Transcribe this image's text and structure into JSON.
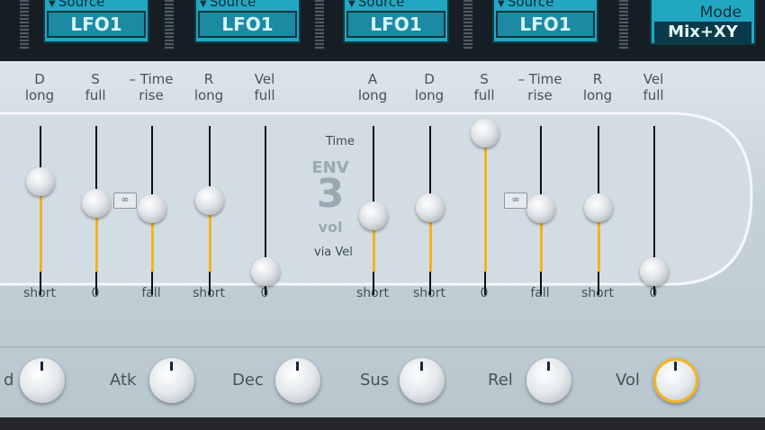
{
  "sources": [
    {
      "label": "Source",
      "value": "LFO1"
    },
    {
      "label": "Source",
      "value": "LFO1"
    },
    {
      "label": "Source",
      "value": "LFO1"
    },
    {
      "label": "Source",
      "value": "LFO1"
    }
  ],
  "mode": {
    "label": "Mode",
    "value": "Mix+XY"
  },
  "env_label": {
    "env": "ENV",
    "number": "3",
    "vol": "vol",
    "time": "Time",
    "via_vel": "via Vel"
  },
  "sliders": [
    {
      "id": "d-left",
      "top": "D",
      "top2": "long",
      "bottom": "short",
      "level": 0.62
    },
    {
      "id": "s-left",
      "top": "S",
      "top2": "full",
      "bottom": "0",
      "level": 0.47
    },
    {
      "id": "time-left",
      "top": "– Time",
      "top2": "rise",
      "bottom": "fall",
      "level": 0.43
    },
    {
      "id": "r-left",
      "top": "R",
      "top2": "long",
      "bottom": "short",
      "level": 0.49
    },
    {
      "id": "vel-left",
      "top": "Vel",
      "top2": "full",
      "bottom": "0",
      "level": 0.0
    },
    {
      "id": "a-right",
      "top": "A",
      "top2": "long",
      "bottom": "short",
      "level": 0.38
    },
    {
      "id": "d-right",
      "top": "D",
      "top2": "long",
      "bottom": "short",
      "level": 0.44
    },
    {
      "id": "s-right",
      "top": "S",
      "top2": "full",
      "bottom": "0",
      "level": 0.95
    },
    {
      "id": "time-right",
      "top": "– Time",
      "top2": "rise",
      "bottom": "fall",
      "level": 0.43
    },
    {
      "id": "r-right",
      "top": "R",
      "top2": "long",
      "bottom": "short",
      "level": 0.44
    },
    {
      "id": "vel-right",
      "top": "Vel",
      "top2": "full",
      "bottom": "0",
      "level": 0.0
    }
  ],
  "knobs": [
    {
      "label": "d"
    },
    {
      "label": "Atk"
    },
    {
      "label": "Dec"
    },
    {
      "label": "Sus"
    },
    {
      "label": "Rel"
    },
    {
      "label": "Vol"
    }
  ]
}
